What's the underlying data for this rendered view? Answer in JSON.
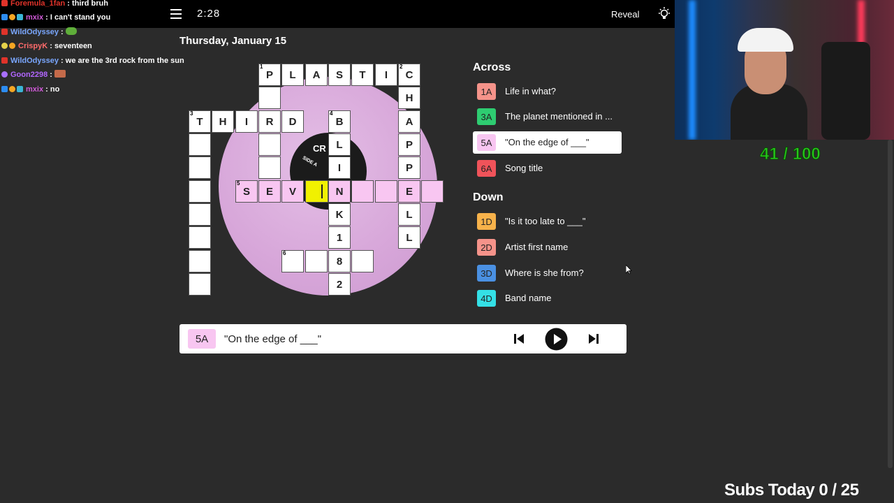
{
  "header": {
    "timer": "2:28",
    "reveal_label": "Reveal",
    "date": "Thursday, January 15"
  },
  "chat": [
    {
      "user": "Foremula_1fan",
      "text": "third bruh",
      "color": "#e0332a"
    },
    {
      "user": "mxix",
      "text": "I can't stand you",
      "color": "#d05ad8"
    },
    {
      "user": "WildOdyssey",
      "text": "",
      "color": "#7aa7ff"
    },
    {
      "user": "CrispyK",
      "text": "seventeen",
      "color": "#ff6b6b"
    },
    {
      "user": "WildOdyssey",
      "text": "we are the 3rd rock from the sun",
      "color": "#7aa7ff"
    },
    {
      "user": "Goon2298",
      "text": "",
      "color": "#b266ff"
    },
    {
      "user": "mxix",
      "text": "no",
      "color": "#d05ad8"
    }
  ],
  "record_label": {
    "top": "CR",
    "side": "SIDE A"
  },
  "grid": {
    "r0": [
      "P",
      "L",
      "A",
      "S",
      "T",
      "I",
      "C"
    ],
    "r1": [
      "",
      "H"
    ],
    "r2": [
      "T",
      "H",
      "I",
      "R",
      "D",
      "B",
      "A"
    ],
    "r3": [
      "",
      "",
      "L",
      "P"
    ],
    "r4": [
      "",
      "",
      "I",
      "P"
    ],
    "r5": [
      "",
      "S",
      "E",
      "V",
      "",
      "",
      "N",
      "",
      "",
      "E",
      ""
    ],
    "r6": [
      "",
      "K",
      "L"
    ],
    "r7": [
      "",
      "1",
      "L"
    ],
    "r8": [
      "",
      "",
      "",
      "8",
      ""
    ],
    "r9": [
      "",
      "2"
    ],
    "nums": {
      "n1": "1",
      "n2": "2",
      "n3": "3",
      "n4": "4",
      "n5": "5",
      "n6": "6"
    }
  },
  "clues": {
    "across_heading": "Across",
    "down_heading": "Down",
    "across": [
      {
        "num": "1A",
        "text": "Life in what?",
        "color": "#f5938a"
      },
      {
        "num": "3A",
        "text": "The planet mentioned in ...",
        "color": "#2ecc71"
      },
      {
        "num": "5A",
        "text": "\"On the edge of ___\"",
        "color": "#f8c6f1"
      },
      {
        "num": "6A",
        "text": "Song title",
        "color": "#f0535a"
      }
    ],
    "down": [
      {
        "num": "1D",
        "text": "\"Is it too late to ___\"",
        "color": "#f7b24a"
      },
      {
        "num": "2D",
        "text": "Artist first name",
        "color": "#f5938a"
      },
      {
        "num": "3D",
        "text": "Where is she from?",
        "color": "#4a90e2"
      },
      {
        "num": "4D",
        "text": "Band name",
        "color": "#34e0e6"
      }
    ]
  },
  "player": {
    "badge": "5A",
    "text": "\"On the edge of ___\""
  },
  "overlay": {
    "score": "41 / 100",
    "subs": "Subs Today  0 / 25"
  }
}
